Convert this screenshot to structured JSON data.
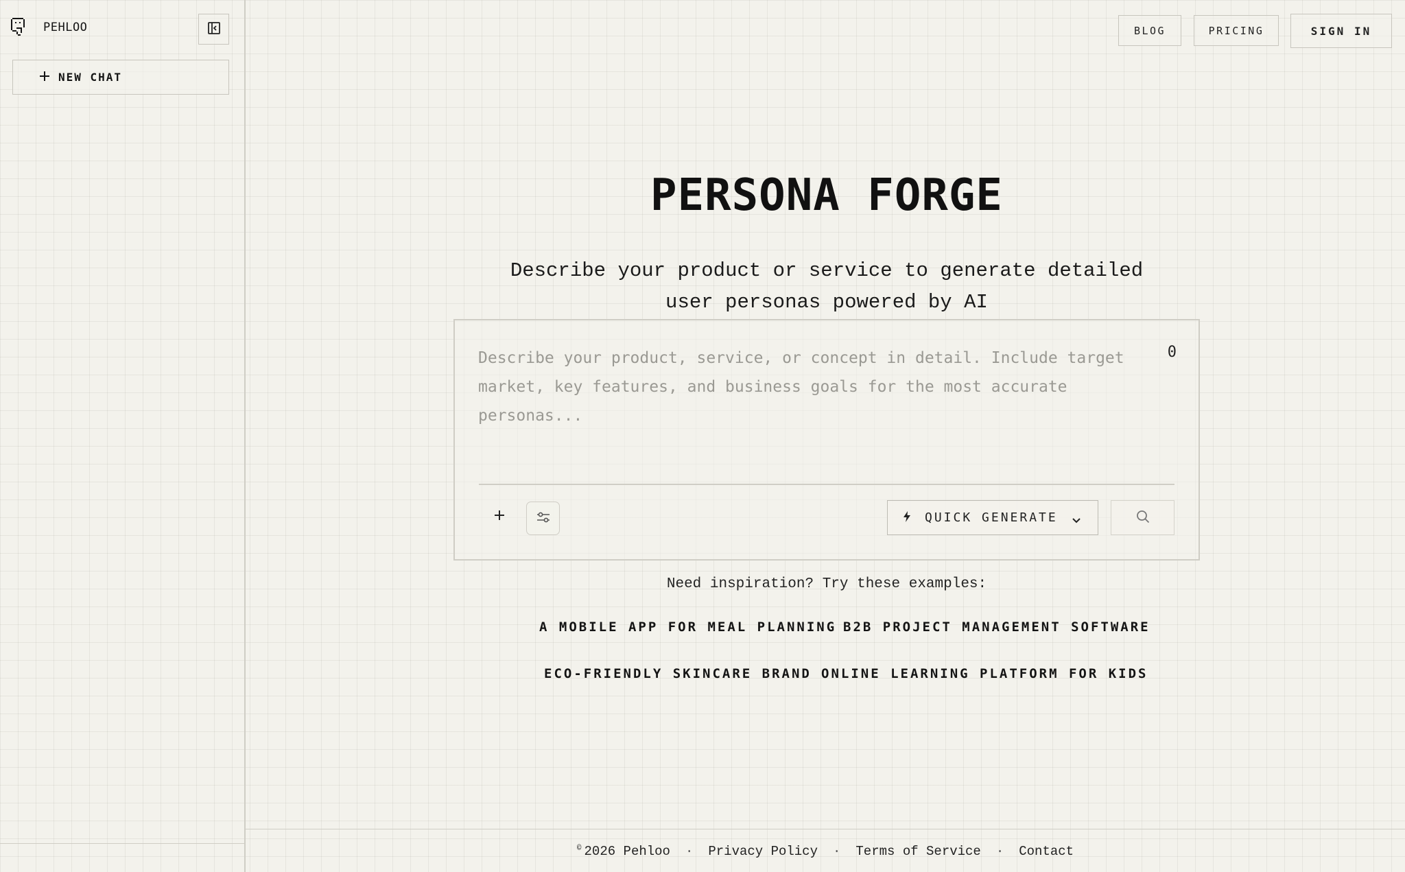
{
  "sidebar": {
    "brand": "PEHLOO",
    "new_chat_label": "NEW CHAT"
  },
  "nav": {
    "blog": "BLOG",
    "pricing": "PRICING",
    "sign_in": "SIGN IN"
  },
  "hero": {
    "title": "PERSONA FORGE",
    "subtitle_line1": "Describe your product or service to generate detailed",
    "subtitle_line2": "user personas powered by AI"
  },
  "input": {
    "placeholder": "Describe your product, service, or concept in detail. Include target market, key features, and business goals for the most accurate personas...",
    "value": "",
    "char_count": "0",
    "mode_label": "QUICK GENERATE",
    "attach_symbol": "+"
  },
  "examples": {
    "heading": "Need inspiration? Try these examples:",
    "items": [
      "A MOBILE APP FOR MEAL PLANNING",
      "B2B PROJECT MANAGEMENT SOFTWARE",
      "ECO-FRIENDLY SKINCARE BRAND",
      "ONLINE LEARNING PLATFORM FOR KIDS"
    ]
  },
  "footer": {
    "copyright_symbol": "©",
    "copyright_text": "2026 Pehloo",
    "separator": "·",
    "links": [
      "Privacy Policy",
      "Terms of Service",
      "Contact"
    ]
  },
  "icons": {
    "logo": "pixel-face-icon",
    "collapse": "sidebar-collapse-icon",
    "new_chat": "plus-icon",
    "settings": "sliders-icon",
    "mode": "lightning-icon",
    "dropdown": "chevron-down-icon",
    "search": "search-icon"
  }
}
